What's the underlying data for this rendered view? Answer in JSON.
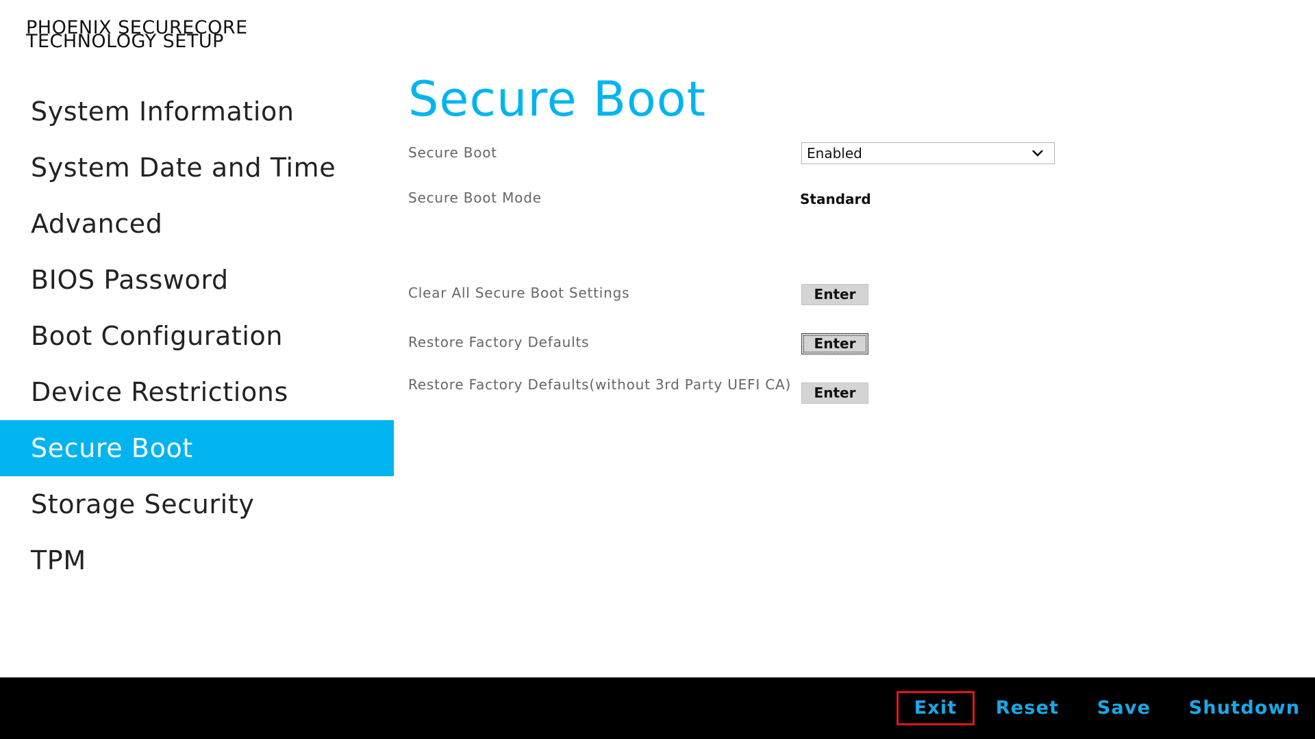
{
  "brand": {
    "line1": "PHOENIX SECURECORE",
    "line2": "TECHNOLOGY SETUP"
  },
  "sidebar": {
    "items": [
      {
        "label": "System Information"
      },
      {
        "label": "System Date and Time"
      },
      {
        "label": "Advanced"
      },
      {
        "label": "BIOS Password"
      },
      {
        "label": "Boot Configuration"
      },
      {
        "label": "Device Restrictions"
      },
      {
        "label": "Secure Boot",
        "active": true
      },
      {
        "label": "Storage Security"
      },
      {
        "label": "TPM"
      }
    ]
  },
  "main": {
    "title": "Secure Boot",
    "secure_boot": {
      "label": "Secure Boot",
      "value": "Enabled"
    },
    "secure_boot_mode": {
      "label": "Secure Boot Mode",
      "value": "Standard"
    },
    "clear_all": {
      "label": "Clear All Secure Boot Settings",
      "button": "Enter"
    },
    "restore_defaults": {
      "label": "Restore Factory Defaults",
      "button": "Enter"
    },
    "restore_defaults_no_3rd": {
      "label": "Restore Factory Defaults(without 3rd Party UEFI CA)",
      "button": "Enter"
    }
  },
  "footer": {
    "exit": "Exit",
    "reset": "Reset",
    "save": "Save",
    "shutdown": "Shutdown"
  },
  "colors": {
    "accent": "#00b4ef",
    "footer_bg": "#000000",
    "footer_text": "#19a9e6",
    "highlight_border": "#e0151b"
  },
  "icons": {
    "dropdown": "chevron-down-icon"
  }
}
